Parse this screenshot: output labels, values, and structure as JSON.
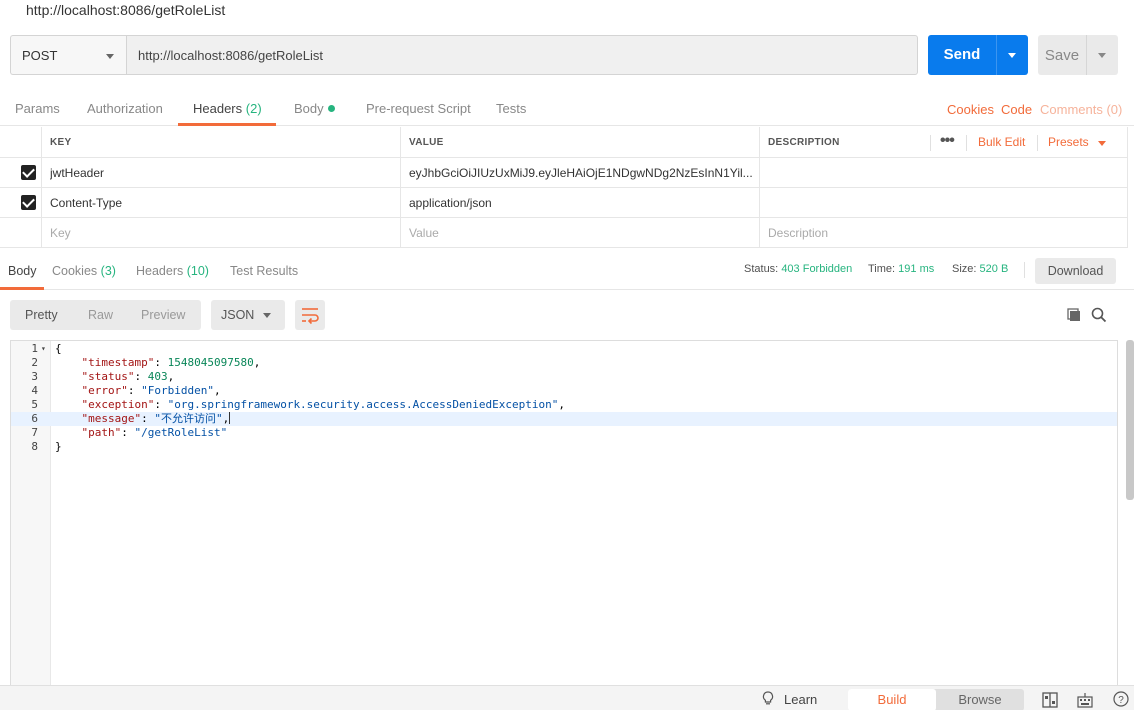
{
  "window": {
    "title": "http://localhost:8086/getRoleList"
  },
  "request": {
    "method": "POST",
    "url": "http://localhost:8086/getRoleList",
    "send_label": "Send",
    "save_label": "Save"
  },
  "request_tabs": [
    {
      "label": "Params"
    },
    {
      "label": "Authorization"
    },
    {
      "label": "Headers",
      "count": "(2)"
    },
    {
      "label": "Body"
    },
    {
      "label": "Pre-request Script"
    },
    {
      "label": "Tests"
    }
  ],
  "request_links": {
    "cookies": "Cookies",
    "code": "Code",
    "comments": "Comments (0)"
  },
  "headers_table": {
    "columns": [
      "KEY",
      "VALUE",
      "DESCRIPTION"
    ],
    "more": "•••",
    "bulk_edit": "Bulk Edit",
    "presets": "Presets",
    "rows": [
      {
        "key": "jwtHeader",
        "value": "eyJhbGciOiJIUzUxMiJ9.eyJleHAiOjE1NDgwNDg2NzEsInN1Yil...",
        "description": "",
        "checked": true
      },
      {
        "key": "Content-Type",
        "value": "application/json",
        "description": "",
        "checked": true
      }
    ],
    "placeholder": {
      "key": "Key",
      "value": "Value",
      "description": "Description"
    }
  },
  "response_tabs": [
    {
      "label": "Body"
    },
    {
      "label": "Cookies",
      "count": "(3)"
    },
    {
      "label": "Headers",
      "count": "(10)"
    },
    {
      "label": "Test Results"
    }
  ],
  "response_status": {
    "status_label": "Status:",
    "status_value": "403 Forbidden",
    "time_label": "Time:",
    "time_value": "191 ms",
    "size_label": "Size:",
    "size_value": "520 B",
    "download": "Download"
  },
  "view": {
    "modes": [
      "Pretty",
      "Raw",
      "Preview"
    ],
    "format": "JSON"
  },
  "editor": {
    "line_numbers": [
      "1",
      "2",
      "3",
      "4",
      "5",
      "6",
      "7",
      "8"
    ],
    "lines": {
      "l1": "{",
      "timestamp_key": "\"timestamp\"",
      "timestamp_val": "1548045097580",
      "status_key": "\"status\"",
      "status_val": "403",
      "error_key": "\"error\"",
      "error_val": "\"Forbidden\"",
      "exception_key": "\"exception\"",
      "exception_val": "\"org.springframework.security.access.AccessDeniedException\"",
      "message_key": "\"message\"",
      "message_val": "\"不允许访问\"",
      "path_key": "\"path\"",
      "path_val": "\"/getRoleList\"",
      "l8": "}"
    }
  },
  "footer": {
    "learn": "Learn",
    "build": "Build",
    "browse": "Browse"
  },
  "colors": {
    "accent": "#f26b3a",
    "send": "#097bed",
    "success": "#26b47f"
  }
}
